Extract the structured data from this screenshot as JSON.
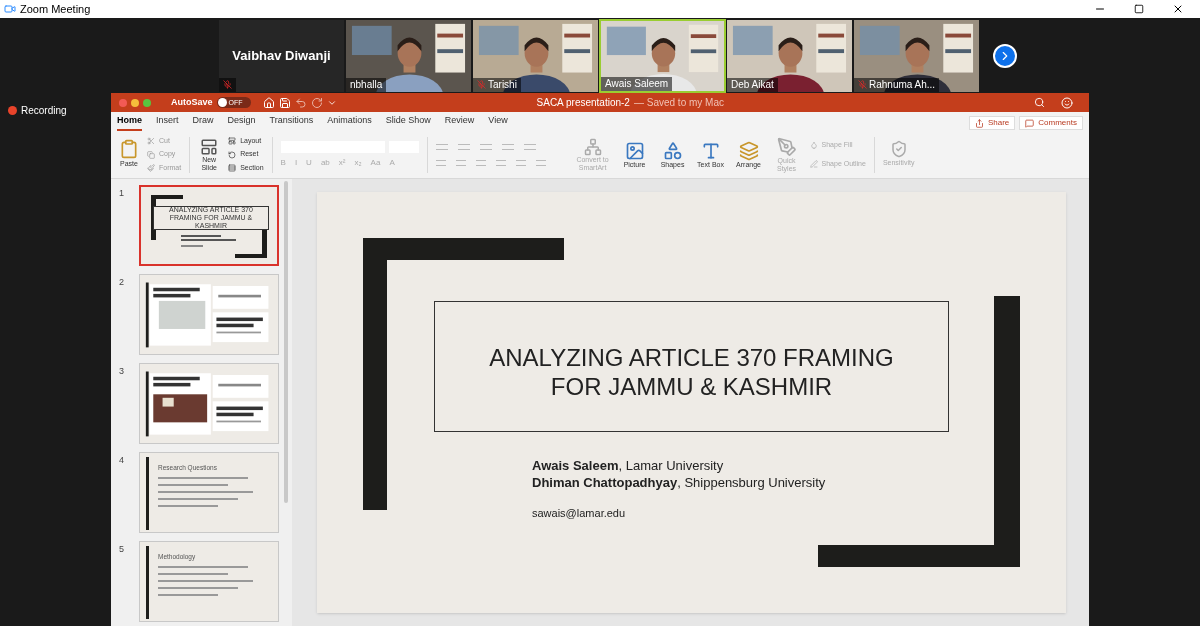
{
  "window": {
    "title": "Zoom Meeting"
  },
  "participants": [
    {
      "name": "Vaibhav Diwanji",
      "kind": "name_only",
      "muted": true,
      "active": false
    },
    {
      "name": "nbhalla",
      "kind": "video",
      "muted": false,
      "active": false
    },
    {
      "name": "Tarishi",
      "kind": "video",
      "muted": true,
      "active": false
    },
    {
      "name": "Awais Saleem",
      "kind": "video",
      "muted": false,
      "active": true
    },
    {
      "name": "Deb Aikat",
      "kind": "video",
      "muted": false,
      "active": false
    },
    {
      "name": "Rahnuma Ah...",
      "kind": "video",
      "muted": true,
      "active": false
    }
  ],
  "recording": {
    "label": "Recording"
  },
  "powerpoint": {
    "autosave": {
      "label": "AutoSave",
      "state": "OFF",
      "on": false
    },
    "title": "SACA presentation-2",
    "saved": "— Saved to my Mac",
    "tabs": [
      {
        "label": "Home",
        "selected": true
      },
      {
        "label": "Insert",
        "selected": false
      },
      {
        "label": "Draw",
        "selected": false
      },
      {
        "label": "Design",
        "selected": false
      },
      {
        "label": "Transitions",
        "selected": false
      },
      {
        "label": "Animations",
        "selected": false
      },
      {
        "label": "Slide Show",
        "selected": false
      },
      {
        "label": "Review",
        "selected": false
      },
      {
        "label": "View",
        "selected": false
      }
    ],
    "share": "Share",
    "comments": "Comments",
    "clipboard": {
      "paste": "Paste",
      "cut": "Cut",
      "copy": "Copy",
      "format": "Format"
    },
    "slides_group": {
      "new_slide": "New Slide",
      "layout": "Layout",
      "reset": "Reset",
      "section": "Section"
    },
    "font_buttons": [
      "B",
      "I",
      "U",
      "ab",
      "x²",
      "x₂",
      "Aa",
      "A"
    ],
    "tools": [
      {
        "label": "Convert to SmartArt",
        "kind": "smartart",
        "disabled": true
      },
      {
        "label": "Picture",
        "kind": "picture",
        "disabled": false
      },
      {
        "label": "Shapes",
        "kind": "shapes",
        "disabled": false
      },
      {
        "label": "Text Box",
        "kind": "textbox",
        "disabled": false
      },
      {
        "label": "Arrange",
        "kind": "arrange",
        "disabled": false
      },
      {
        "label": "Quick Styles",
        "kind": "styles",
        "disabled": true
      }
    ],
    "shape_fill": "Shape Fill",
    "shape_outline": "Shape Outline",
    "sensitivity": "Sensitivity",
    "thumbnails": [
      {
        "number": "1",
        "selected": true,
        "kind": "title",
        "title": "ANALYZING ARTICLE 370 FRAMING FOR JAMMU & KASHMIR"
      },
      {
        "number": "2",
        "selected": false,
        "kind": "news"
      },
      {
        "number": "3",
        "selected": false,
        "kind": "news"
      },
      {
        "number": "4",
        "selected": false,
        "kind": "list",
        "title": "Research Questions"
      },
      {
        "number": "5",
        "selected": false,
        "kind": "list",
        "title": "Methodology"
      }
    ],
    "slide": {
      "title_lines": [
        "ANALYZING ARTICLE 370 FRAMING",
        "FOR JAMMU & KASHMIR"
      ],
      "authors": [
        "**Awais Saleem**, Lamar University",
        "**Dhiman Chattopadhyay**, Shippensburg University"
      ],
      "email": "sawais@lamar.edu"
    }
  }
}
